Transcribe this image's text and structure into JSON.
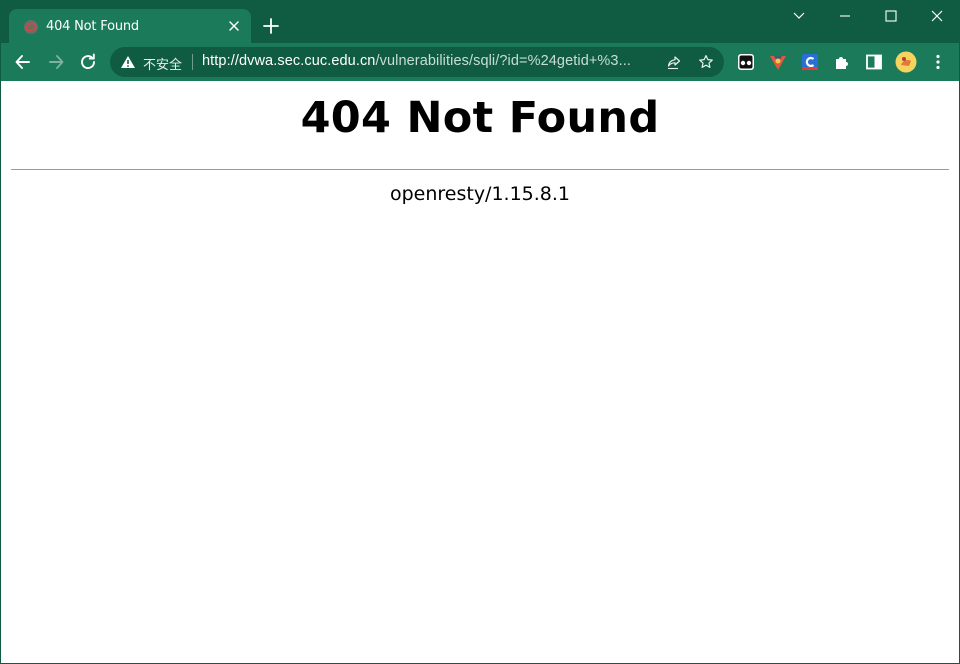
{
  "tab": {
    "title": "404 Not Found"
  },
  "omnibox": {
    "security_label": "不安全",
    "url_host": "http://dvwa.sec.cuc.edu.cn",
    "url_path": "/vulnerabilities/sqli/?id=%24getid+%3..."
  },
  "page": {
    "heading": "404 Not Found",
    "server": "openresty/1.15.8.1"
  },
  "colors": {
    "chrome_dark": "#0f5c43",
    "chrome_light": "#1b7a59",
    "page_bg": "#ffffff"
  },
  "icons": {
    "tab": [
      "favicon-icon",
      "close-icon",
      "plus-icon"
    ],
    "window": [
      "chevron-down-icon",
      "minimize-icon",
      "maximize-icon",
      "close-window-icon"
    ],
    "toolbar": [
      "back-icon",
      "forward-icon",
      "reload-icon",
      "warning-icon",
      "share-icon",
      "star-icon",
      "extension-icon",
      "sidebar-icon",
      "profile-avatar",
      "menu-icon"
    ]
  }
}
